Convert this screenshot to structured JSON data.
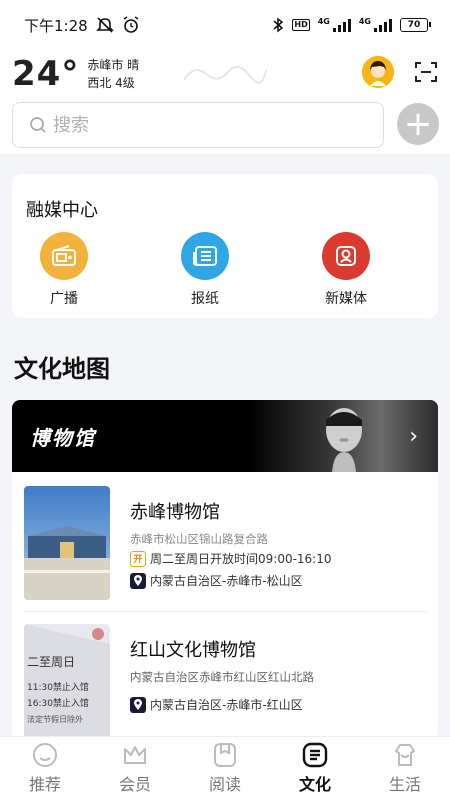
{
  "status_bar": {
    "time": "下午1:28",
    "network_1": "4G",
    "network_2": "4G",
    "hd_label": "HD",
    "battery": "70"
  },
  "header": {
    "temperature": "24°",
    "city_weather": "赤峰市 晴",
    "wind": "西北 4级",
    "search_placeholder": "搜索"
  },
  "media_center": {
    "title": "融媒中心",
    "items": [
      {
        "label": "广播",
        "icon": "radio-icon",
        "color": "#f4b13c"
      },
      {
        "label": "报纸",
        "icon": "newspaper-icon",
        "color": "#2fa6e6"
      },
      {
        "label": "新媒体",
        "icon": "new-media-icon",
        "color": "#d93b2f"
      }
    ]
  },
  "culture_map": {
    "title": "文化地图",
    "banner_title": "博物馆",
    "museums": [
      {
        "name": "赤峰博物馆",
        "address": "赤峰市松山区锦山路复合路",
        "open_badge": "开",
        "hours": "周二至周日开放时间09:00-16:10",
        "region": "内蒙古自治区-赤峰市-松山区"
      },
      {
        "name": "红山文化博物馆",
        "address": "内蒙古自治区赤峰市红山区红山北路",
        "region": "内蒙古自治区-赤峰市-红山区",
        "image_text": [
          "二至周日",
          "11:30禁止入馆",
          "16:30禁止入馆",
          "法定节假日除外"
        ]
      }
    ]
  },
  "tabbar": {
    "tabs": [
      {
        "label": "推荐",
        "icon": "recommend-icon"
      },
      {
        "label": "会员",
        "icon": "crown-icon"
      },
      {
        "label": "阅读",
        "icon": "reading-icon"
      },
      {
        "label": "文化",
        "icon": "culture-icon",
        "active": true
      },
      {
        "label": "生活",
        "icon": "life-icon"
      }
    ]
  }
}
